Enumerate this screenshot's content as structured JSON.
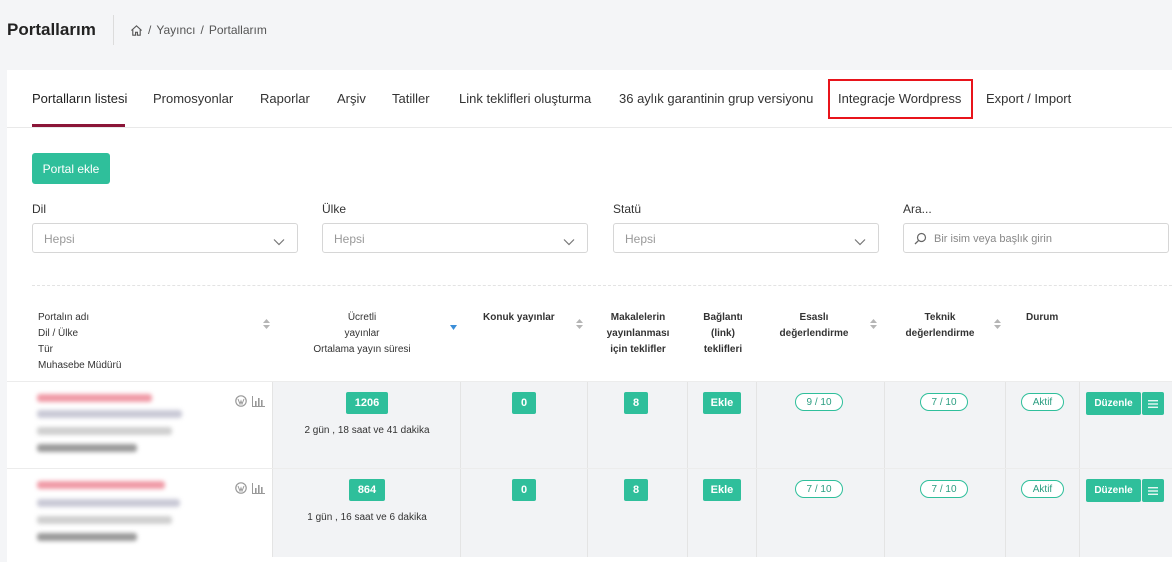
{
  "header": {
    "title": "Portallarım",
    "breadcrumb": [
      "Yayıncı",
      "Portallarım"
    ],
    "breadcrumb_sep": "/"
  },
  "tabs": [
    {
      "label": "Portalların listesi",
      "active": true
    },
    {
      "label": "Promosyonlar"
    },
    {
      "label": "Raporlar"
    },
    {
      "label": "Arşiv"
    },
    {
      "label": "Tatiller"
    },
    {
      "label": "Link teklifleri oluşturma"
    },
    {
      "label": "36 aylık garantinin grup versiyonu"
    },
    {
      "label": "Integracje Wordpress",
      "highlighted": true
    },
    {
      "label": "Export / Import"
    }
  ],
  "add_button": "Portal ekle",
  "filters": {
    "dil": {
      "label": "Dil",
      "value": "Hepsi"
    },
    "ulke": {
      "label": "Ülke",
      "value": "Hepsi"
    },
    "statu": {
      "label": "Statü",
      "value": "Hepsi"
    },
    "ara": {
      "label": "Ara...",
      "placeholder": "Bir isim veya başlık girin"
    }
  },
  "table": {
    "headers": {
      "portal": [
        "Portalın adı",
        "Dil / Ülke",
        "Tür",
        "Muhasebe Müdürü"
      ],
      "paid": [
        "Ücretli",
        "yayınlar",
        "Ortalama yayın süresi"
      ],
      "guest": "Konuk yayınlar",
      "offers": [
        "Makalelerin",
        "yayınlanması",
        "için teklifler"
      ],
      "links": [
        "Bağlantı",
        "(link)",
        "teklifleri"
      ],
      "essential": [
        "Esaslı",
        "değerlendirme"
      ],
      "technical": [
        "Teknik",
        "değerlendirme"
      ],
      "status": "Durum"
    },
    "rows": [
      {
        "paid": "1206",
        "duration": "2 gün , 18 saat ve 41 dakika",
        "guest": "0",
        "offers": "8",
        "link_btn": "Ekle",
        "essential": "9 / 10",
        "technical": "7 / 10",
        "status": "Aktif",
        "edit": "Düzenle"
      },
      {
        "paid": "864",
        "duration": "1 gün , 16 saat ve 6 dakika",
        "guest": "0",
        "offers": "8",
        "link_btn": "Ekle",
        "essential": "7 / 10",
        "technical": "7 / 10",
        "status": "Aktif",
        "edit": "Düzenle"
      }
    ]
  },
  "colors": {
    "accent": "#2fbf9b",
    "tab_underline": "#8b1538",
    "highlight": "#e8141b"
  }
}
